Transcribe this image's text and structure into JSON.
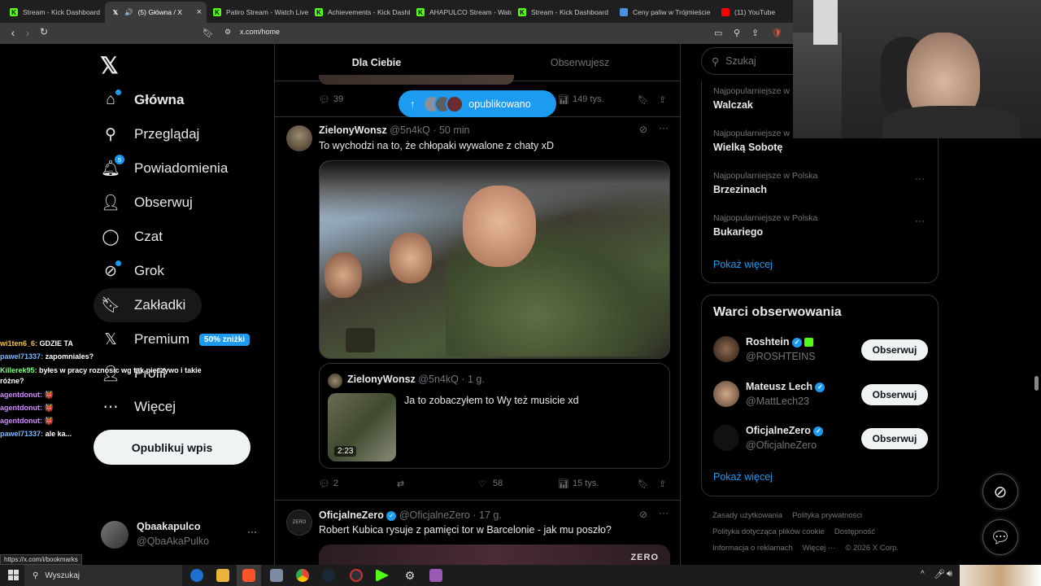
{
  "browser": {
    "tabs": [
      {
        "label": "Stream - Kick Dashboard",
        "fav": "kick-icon",
        "color": "#53fc18"
      },
      {
        "label": "(5) Główna / X",
        "fav": "x-icon",
        "color": "#ffffff",
        "active": true,
        "audio": "🔊"
      },
      {
        "label": "Patiro Stream - Watch Live",
        "fav": "kick-icon",
        "color": "#53fc18"
      },
      {
        "label": "Achievements - Kick Dashb",
        "fav": "kick-icon",
        "color": "#53fc18"
      },
      {
        "label": "AHAPULCO Stream - Watch",
        "fav": "kick-icon",
        "color": "#53fc18"
      },
      {
        "label": "Stream - Kick Dashboard",
        "fav": "kick-icon",
        "color": "#53fc18"
      },
      {
        "label": "Ceny paliw w Trójmieście",
        "fav": "page-icon",
        "color": "#4a90e2"
      },
      {
        "label": "(11) YouTube",
        "fav": "youtube-icon",
        "color": "#ff0000"
      }
    ],
    "close": "×",
    "url": "x.com/home",
    "status_url": "https://x.com/i/bookmarks"
  },
  "nav": {
    "logo": "𝕏",
    "items": [
      {
        "label": "Główna",
        "icon": "home-icon",
        "glyph": "⌂"
      },
      {
        "label": "Przeglądaj",
        "icon": "search-icon",
        "glyph": "⚲"
      },
      {
        "label": "Powiadomienia",
        "icon": "bell-icon",
        "glyph": "🔔︎",
        "badge": "5"
      },
      {
        "label": "Obserwuj",
        "icon": "follow-icon",
        "glyph": "👤︎"
      },
      {
        "label": "Czat",
        "icon": "chat-icon",
        "glyph": "◯"
      },
      {
        "label": "Grok",
        "icon": "grok-icon",
        "glyph": "⊘"
      },
      {
        "label": "Zakładki",
        "icon": "bookmark-icon",
        "glyph": "🔖︎"
      },
      {
        "label": "Premium",
        "icon": "x-premium-icon",
        "glyph": "𝕏",
        "badge_text": "50% zniżki"
      },
      {
        "label": "Profil",
        "icon": "profile-icon",
        "glyph": "👤︎"
      },
      {
        "label": "Więcej",
        "icon": "more-icon",
        "glyph": "⋯"
      }
    ],
    "post_button": "Opublikuj wpis",
    "profile": {
      "name": "Qbaakapulco",
      "handle": "@QbaAkaPulko",
      "more": "···"
    }
  },
  "feed": {
    "tabs": [
      "Dla Ciebie",
      "Obserwujesz"
    ],
    "new_posts_pill": "opublikowano",
    "prev_actions": {
      "replies": "39",
      "views": "149 tys."
    },
    "tweets": [
      {
        "name": "ZielonyWonsz",
        "handle": "@5n4kQ",
        "time": "· 50 min",
        "text": "To wychodzi na to, że chłopaki wywalone z chaty xD",
        "quote": {
          "name": "ZielonyWonsz",
          "handle": "@5n4kQ",
          "time": "· 1 g.",
          "text": "Ja to zobaczyłem to Wy też musicie xd",
          "duration": "2:23"
        },
        "actions": {
          "replies": "2",
          "likes": "58",
          "views": "15 tys."
        }
      },
      {
        "name": "OficjalneZero",
        "handle": "@OficjalneZero",
        "time": "· 17 g.",
        "text": "Robert Kubica rysuje z pamięci tor w Barcelonie - jak mu poszło?",
        "media_logo": "ZERO"
      }
    ]
  },
  "right": {
    "search_placeholder": "Szukaj",
    "trends": [
      {
        "context": "Najpopularniejsze w",
        "name": "Walczak"
      },
      {
        "context": "Najpopularniejsze w",
        "name": "Wielką Sobotę"
      },
      {
        "context": "Najpopularniejsze w Polska",
        "name": "Brzezinach"
      },
      {
        "context": "Najpopularniejsze w Polska",
        "name": "Bukariego"
      }
    ],
    "show_more": "Pokaż więcej",
    "who_title": "Warci obserwowania",
    "who": [
      {
        "name": "Roshtein",
        "handle": "@ROSHTEINS",
        "button": "Obserwuj"
      },
      {
        "name": "Mateusz Lech",
        "handle": "@MattLech23",
        "button": "Obserwuj"
      },
      {
        "name": "OficjalneZero",
        "handle": "@OficjalneZero",
        "button": "Obserwuj"
      }
    ],
    "who_more": "Pokaż więcej",
    "footer": [
      "Zasady użytkowania",
      "Polityka prywatności",
      "Polityka dotycząca plików cookie",
      "Dostępność",
      "Informacja o reklamach",
      "Więcej ···",
      "© 2026 X Corp."
    ]
  },
  "chat": [
    {
      "user": "wi1ten6_6:",
      "msg": "GDZIE TA",
      "color": "#f5c542"
    },
    {
      "user": "pawel71337:",
      "msg": "zapomniales?",
      "color": "#7fb7ff"
    },
    {
      "user": "Killerek95:",
      "msg": "byłes w pracy roznosic wg tak pieczywo i takie różne?",
      "color": "#7fff7f"
    },
    {
      "user": "agentdonut:",
      "msg": "👹",
      "color": "#d08bff"
    },
    {
      "user": "agentdonut:",
      "msg": "👹",
      "color": "#d08bff"
    },
    {
      "user": "agentdonut:",
      "msg": "👹",
      "color": "#d08bff"
    },
    {
      "user": "pawel71337:",
      "msg": "ale ka...",
      "color": "#7fb7ff"
    }
  ],
  "taskbar": {
    "search": "Wyszukaj"
  }
}
